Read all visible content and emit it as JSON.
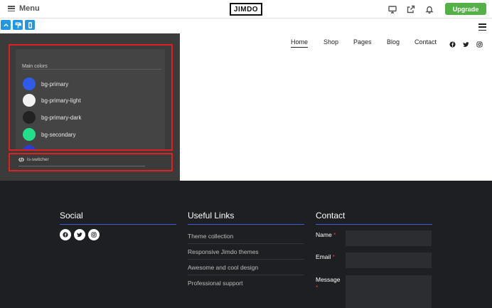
{
  "editor": {
    "menu_label": "Menu",
    "logo": "JIMDO",
    "upgrade_label": "Upgrade",
    "top_icons": [
      "desktop-icon",
      "share-icon",
      "bell-icon"
    ],
    "toolbar_icons": [
      "chevron-up-icon",
      "paint-roller-icon",
      "mobile-icon"
    ]
  },
  "site_nav": {
    "items": [
      "Home",
      "Shop",
      "Pages",
      "Blog",
      "Contact"
    ],
    "active": "Home",
    "social_icons": [
      "facebook-icon",
      "twitter-icon",
      "instagram-icon"
    ]
  },
  "panel": {
    "section_title": "Main colors",
    "colors": [
      {
        "name": "bg-primary",
        "color": "#2f5bea"
      },
      {
        "name": "bg-primary-light",
        "color": "#f2f2f2"
      },
      {
        "name": "bg-primary-dark",
        "color": "#222222"
      },
      {
        "name": "bg-secondary",
        "color": "#22e08a"
      }
    ],
    "class_name": "is-switcher",
    "side_tools": [
      "code-icon",
      "undo-icon",
      "trash-icon",
      "copy-icon"
    ]
  },
  "footer": {
    "social_heading": "Social",
    "links_heading": "Useful Links",
    "contact_heading": "Contact",
    "links": [
      "Theme collection",
      "Responsive Jimdo themes",
      "Awesome and cool design",
      "Professional support"
    ],
    "form": {
      "name_label": "Name",
      "email_label": "Email",
      "message_label": "Message",
      "required_mark": "*"
    }
  }
}
